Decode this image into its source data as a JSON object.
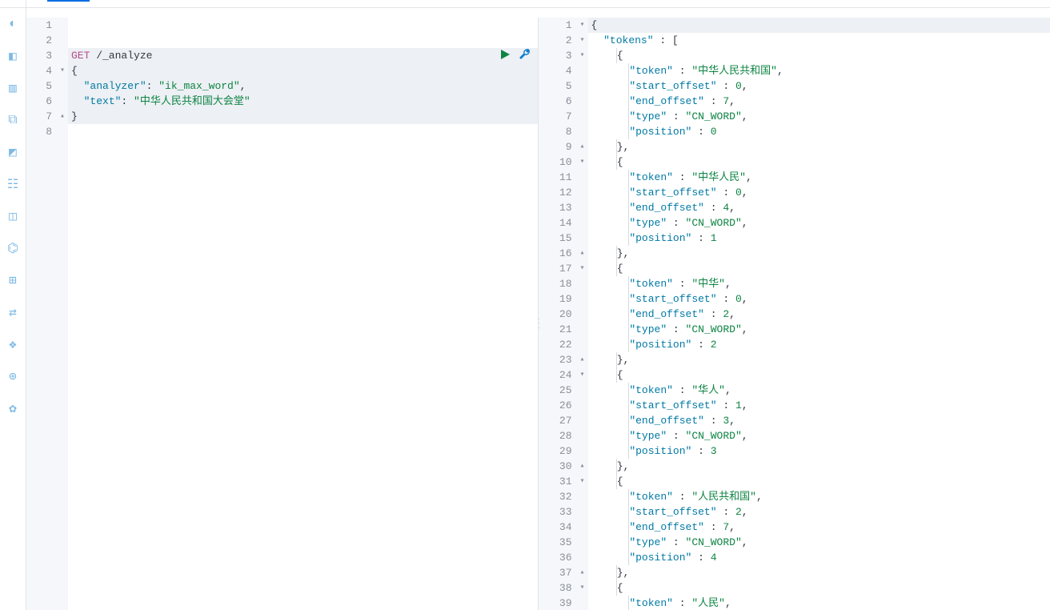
{
  "left": {
    "lines": {
      "l1": "",
      "l2": "",
      "method": "GET",
      "path": " /_analyze",
      "brace_open": "{",
      "analyzer_key": "\"analyzer\"",
      "analyzer_val": "\"ik_max_word\"",
      "text_key": "\"text\"",
      "text_val": "\"中华人民共和国大会堂\"",
      "brace_close": "}",
      "l8": ""
    },
    "fold": {
      "f3": "",
      "f4": "▾",
      "f7": "▴"
    },
    "gutter": [
      "1",
      "2",
      "3",
      "4",
      "5",
      "6",
      "7",
      "8"
    ]
  },
  "right": {
    "gutter": [
      "1",
      "2",
      "3",
      "4",
      "5",
      "6",
      "7",
      "8",
      "9",
      "10",
      "11",
      "12",
      "13",
      "14",
      "15",
      "16",
      "17",
      "18",
      "19",
      "20",
      "21",
      "22",
      "23",
      "24",
      "25",
      "26",
      "27",
      "28",
      "29",
      "30",
      "31",
      "32",
      "33",
      "34",
      "35",
      "36",
      "37",
      "38",
      "39"
    ],
    "fold": {
      "f1": "▾",
      "f2": "▾",
      "f3": "▾",
      "f9": "▴",
      "f10": "▾",
      "f16": "▴",
      "f17": "▾",
      "f23": "▴",
      "f24": "▾",
      "f30": "▴",
      "f31": "▾",
      "f37": "▴",
      "f38": "▾"
    },
    "tokens_key": "\"tokens\"",
    "rows": [
      {
        "token": "\"中华人民共和国\"",
        "start": "0",
        "end": "7",
        "type": "\"CN_WORD\"",
        "pos": "0"
      },
      {
        "token": "\"中华人民\"",
        "start": "0",
        "end": "4",
        "type": "\"CN_WORD\"",
        "pos": "1"
      },
      {
        "token": "\"中华\"",
        "start": "0",
        "end": "2",
        "type": "\"CN_WORD\"",
        "pos": "2"
      },
      {
        "token": "\"华人\"",
        "start": "1",
        "end": "3",
        "type": "\"CN_WORD\"",
        "pos": "3"
      },
      {
        "token": "\"人民共和国\"",
        "start": "2",
        "end": "7",
        "type": "\"CN_WORD\"",
        "pos": "4"
      },
      {
        "token": "\"人民\"",
        "start": "",
        "end": "",
        "type": "",
        "pos": ""
      }
    ],
    "labels": {
      "token": "\"token\"",
      "start": "\"start_offset\"",
      "end": "\"end_offset\"",
      "type": "\"type\"",
      "pos": "\"position\""
    }
  },
  "icons": {
    "run": "run",
    "wrench": "wrench"
  }
}
